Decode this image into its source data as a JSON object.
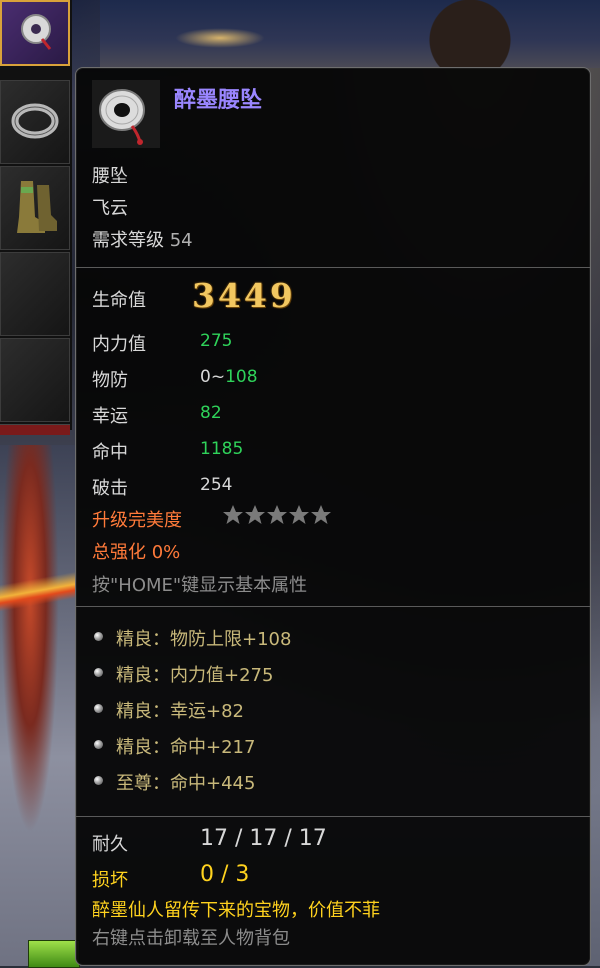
{
  "item": {
    "name": "醉墨腰坠",
    "type": "腰坠",
    "class": "飞云",
    "level_req_label": "需求等级",
    "level_req_value": "54"
  },
  "stats": {
    "hp_label": "生命值",
    "hp_value": "3449",
    "mp_label": "内力值",
    "mp_value": "275",
    "def_label": "物防",
    "def_base": "0~",
    "def_value": "108",
    "luck_label": "幸运",
    "luck_value": "82",
    "hit_label": "命中",
    "hit_value": "1185",
    "crit_label": "破击",
    "crit_value": "254",
    "upgrade_label": "升级完美度",
    "upgrade_stars": 5,
    "enhance_label": "总强化 0%",
    "home_hint": "按\"HOME\"键显示基本属性"
  },
  "bonuses": [
    "精良：物防上限+108",
    "精良：内力值+275",
    "精良：幸运+82",
    "精良：命中+217",
    "至尊：命中+445"
  ],
  "footer": {
    "durability_label": "耐久",
    "durability_value": "17 / 17 / 17",
    "damage_label": "损坏",
    "damage_value": "0 / 3",
    "description": "醉墨仙人留传下来的宝物，价值不菲",
    "hint": "右键点击卸载至人物背包"
  },
  "colors": {
    "item_name": "#9a86ff",
    "green_value": "#2fd35a",
    "orange_text": "#ff7a3a",
    "gold_hp": "#f2c760",
    "bonus_text": "#c8b87a",
    "damage_text": "#ffd21e"
  },
  "icons": {
    "item": "jade-pendant-icon",
    "slot1": "pendant-icon",
    "slot2": "ring-icon",
    "slot3": "boots-icon",
    "star": "star-icon",
    "bullet": "bullet-icon"
  }
}
